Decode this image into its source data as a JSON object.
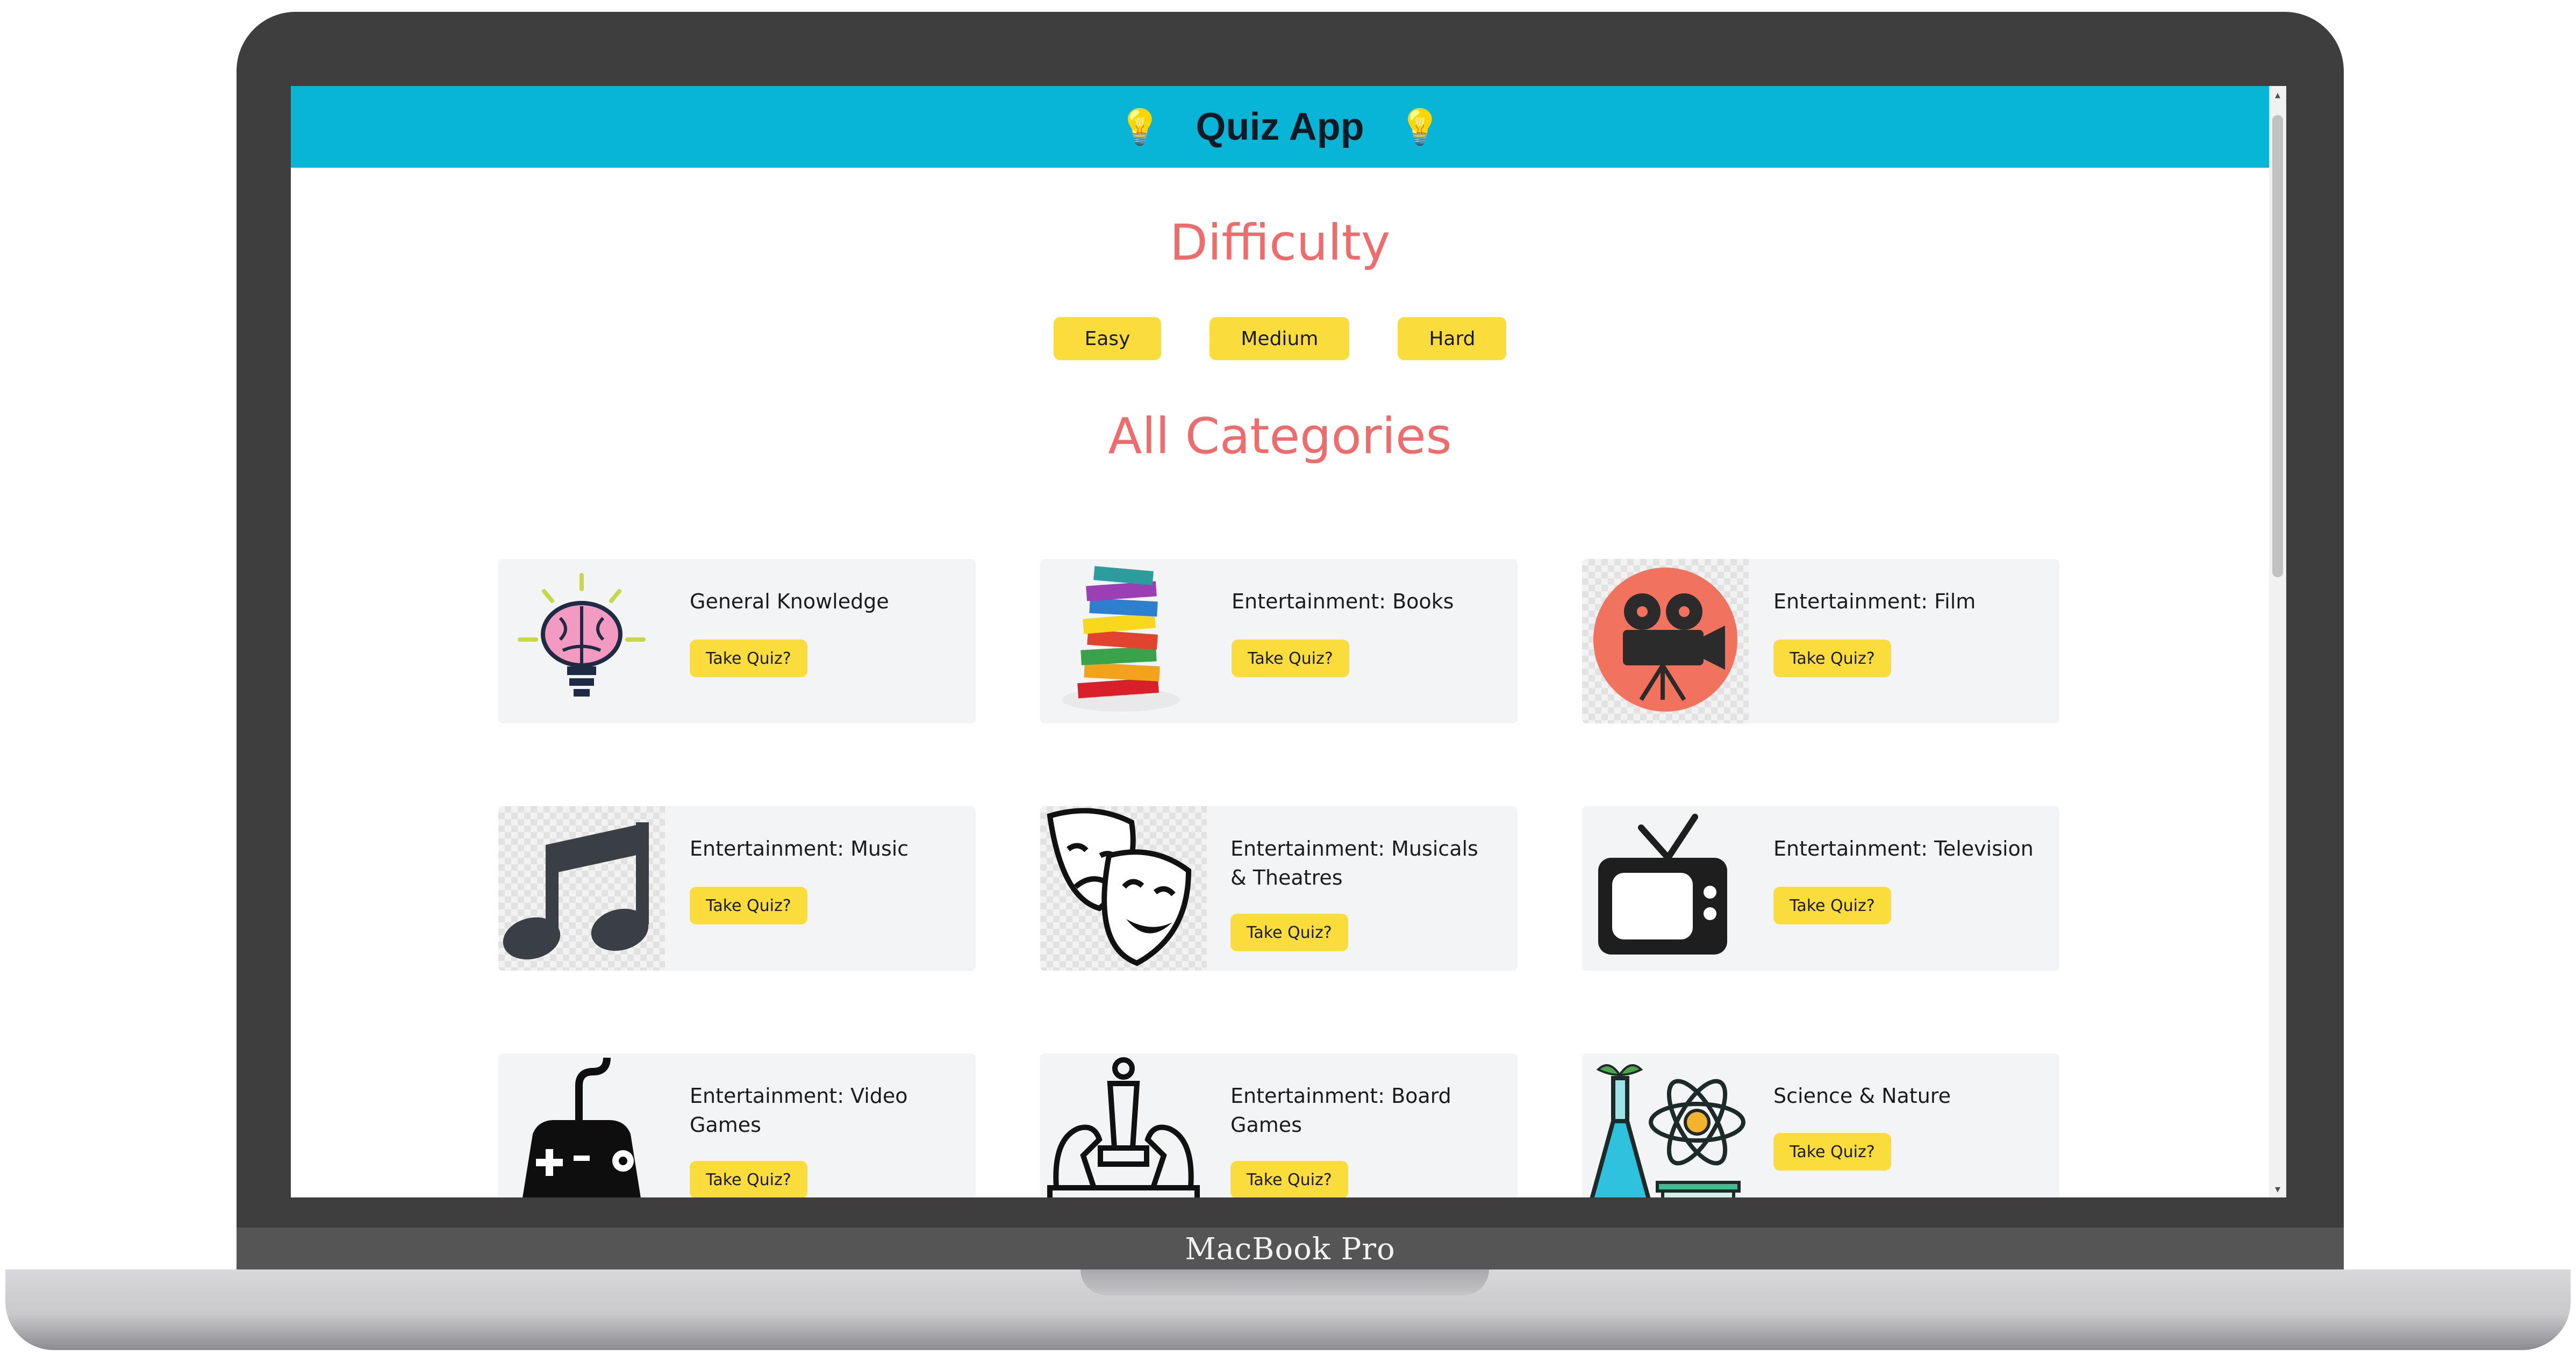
{
  "device": {
    "label": "MacBook Pro"
  },
  "header": {
    "title": "Quiz App",
    "icon": "lightbulb-icon",
    "color": "#08b5d6"
  },
  "difficulty": {
    "heading": "Difficulty",
    "options": [
      "Easy",
      "Medium",
      "Hard"
    ]
  },
  "categories": {
    "heading": "All Categories",
    "take_quiz_label": "Take Quiz?",
    "items": [
      {
        "name": "General Knowledge",
        "icon": "brain-lightbulb-icon"
      },
      {
        "name": "Entertainment: Books",
        "icon": "book-stack-icon"
      },
      {
        "name": "Entertainment: Film",
        "icon": "film-camera-icon"
      },
      {
        "name": "Entertainment: Music",
        "icon": "music-note-icon"
      },
      {
        "name": "Entertainment: Musicals & Theatres",
        "icon": "theatre-masks-icon"
      },
      {
        "name": "Entertainment: Television",
        "icon": "television-icon"
      },
      {
        "name": "Entertainment: Video Games",
        "icon": "gamepad-icon"
      },
      {
        "name": "Entertainment: Board Games",
        "icon": "chess-pieces-icon"
      },
      {
        "name": "Science & Nature",
        "icon": "science-flask-atom-icon"
      }
    ]
  },
  "colors": {
    "heading": "#f06b6b",
    "button": "#fadc3b",
    "card_background": "#f3f4f6"
  }
}
